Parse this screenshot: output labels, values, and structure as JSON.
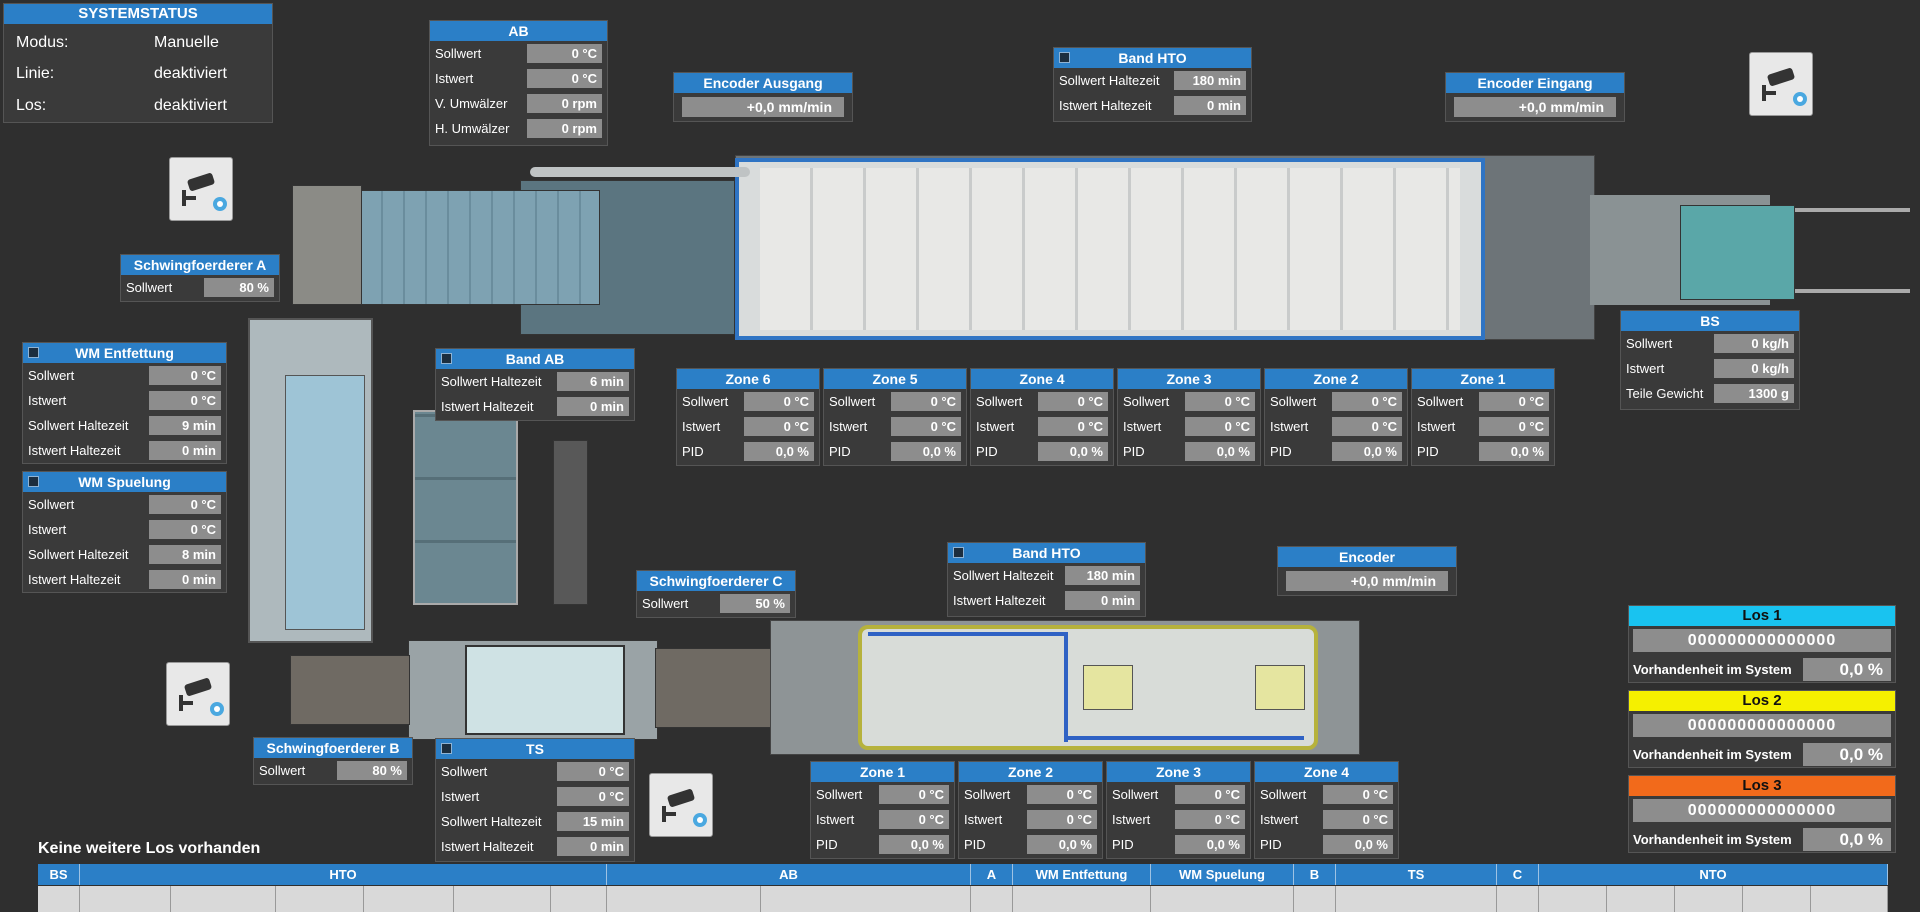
{
  "system_status": {
    "title": "SYSTEMSTATUS",
    "rows": [
      {
        "label": "Modus:",
        "value": "Manuelle"
      },
      {
        "label": "Linie:",
        "value": "deaktiviert"
      },
      {
        "label": "Los:",
        "value": "deaktiviert"
      }
    ]
  },
  "ab": {
    "title": "AB",
    "rows": [
      {
        "label": "Sollwert",
        "value": "0 °C"
      },
      {
        "label": "Istwert",
        "value": "0 °C"
      },
      {
        "label": "V. Umwälzer",
        "value": "0 rpm"
      },
      {
        "label": "H. Umwälzer",
        "value": "0 rpm"
      }
    ]
  },
  "encoder_ausgang": {
    "title": "Encoder Ausgang",
    "value": "+0,0 mm/min"
  },
  "band_hto_top": {
    "title": "Band HTO",
    "rows": [
      {
        "label": "Sollwert Haltezeit",
        "value": "180 min"
      },
      {
        "label": "Istwert Haltezeit",
        "value": "0 min"
      }
    ]
  },
  "encoder_eingang": {
    "title": "Encoder Eingang",
    "value": "+0,0 mm/min"
  },
  "schwingfoerderer_a": {
    "title": "Schwingfoerderer A",
    "rows": [
      {
        "label": "Sollwert",
        "value": "80 %"
      }
    ]
  },
  "wm_entfettung": {
    "title": "WM Entfettung",
    "rows": [
      {
        "label": "Sollwert",
        "value": "0 °C"
      },
      {
        "label": "Istwert",
        "value": "0 °C"
      },
      {
        "label": "Sollwert Haltezeit",
        "value": "9 min"
      },
      {
        "label": "Istwert Haltezeit",
        "value": "0 min"
      }
    ]
  },
  "wm_spuelung": {
    "title": "WM Spuelung",
    "rows": [
      {
        "label": "Sollwert",
        "value": "0 °C"
      },
      {
        "label": "Istwert",
        "value": "0 °C"
      },
      {
        "label": "Sollwert Haltezeit",
        "value": "8 min"
      },
      {
        "label": "Istwert Haltezeit",
        "value": "0 min"
      }
    ]
  },
  "band_ab": {
    "title": "Band AB",
    "rows": [
      {
        "label": "Sollwert Haltezeit",
        "value": "6 min"
      },
      {
        "label": "Istwert Haltezeit",
        "value": "0 min"
      }
    ]
  },
  "bs": {
    "title": "BS",
    "rows": [
      {
        "label": "Sollwert",
        "value": "0 kg/h"
      },
      {
        "label": "Istwert",
        "value": "0 kg/h"
      },
      {
        "label": "Teile Gewicht",
        "value": "1300 g"
      }
    ]
  },
  "top_zones": [
    {
      "title": "Zone 6",
      "rows": [
        {
          "label": "Sollwert",
          "value": "0 °C"
        },
        {
          "label": "Istwert",
          "value": "0 °C"
        },
        {
          "label": "PID",
          "value": "0,0 %"
        }
      ]
    },
    {
      "title": "Zone 5",
      "rows": [
        {
          "label": "Sollwert",
          "value": "0 °C"
        },
        {
          "label": "Istwert",
          "value": "0 °C"
        },
        {
          "label": "PID",
          "value": "0,0 %"
        }
      ]
    },
    {
      "title": "Zone 4",
      "rows": [
        {
          "label": "Sollwert",
          "value": "0 °C"
        },
        {
          "label": "Istwert",
          "value": "0 °C"
        },
        {
          "label": "PID",
          "value": "0,0 %"
        }
      ]
    },
    {
      "title": "Zone 3",
      "rows": [
        {
          "label": "Sollwert",
          "value": "0 °C"
        },
        {
          "label": "Istwert",
          "value": "0 °C"
        },
        {
          "label": "PID",
          "value": "0,0 %"
        }
      ]
    },
    {
      "title": "Zone 2",
      "rows": [
        {
          "label": "Sollwert",
          "value": "0 °C"
        },
        {
          "label": "Istwert",
          "value": "0 °C"
        },
        {
          "label": "PID",
          "value": "0,0 %"
        }
      ]
    },
    {
      "title": "Zone 1",
      "rows": [
        {
          "label": "Sollwert",
          "value": "0 °C"
        },
        {
          "label": "Istwert",
          "value": "0 °C"
        },
        {
          "label": "PID",
          "value": "0,0 %"
        }
      ]
    }
  ],
  "band_hto_bottom": {
    "title": "Band HTO",
    "rows": [
      {
        "label": "Sollwert Haltezeit",
        "value": "180 min"
      },
      {
        "label": "Istwert Haltezeit",
        "value": "0 min"
      }
    ]
  },
  "encoder_bottom": {
    "title": "Encoder",
    "value": "+0,0 mm/min"
  },
  "schwingfoerderer_c": {
    "title": "Schwingfoerderer C",
    "rows": [
      {
        "label": "Sollwert",
        "value": "50 %"
      }
    ]
  },
  "schwingfoerderer_b": {
    "title": "Schwingfoerderer B",
    "rows": [
      {
        "label": "Sollwert",
        "value": "80 %"
      }
    ]
  },
  "ts": {
    "title": "TS",
    "rows": [
      {
        "label": "Sollwert",
        "value": "0 °C"
      },
      {
        "label": "Istwert",
        "value": "0 °C"
      },
      {
        "label": "Sollwert Haltezeit",
        "value": "15 min"
      },
      {
        "label": "Istwert Haltezeit",
        "value": "0 min"
      }
    ]
  },
  "bottom_zones": [
    {
      "title": "Zone 1",
      "rows": [
        {
          "label": "Sollwert",
          "value": "0 °C"
        },
        {
          "label": "Istwert",
          "value": "0 °C"
        },
        {
          "label": "PID",
          "value": "0,0 %"
        }
      ]
    },
    {
      "title": "Zone 2",
      "rows": [
        {
          "label": "Sollwert",
          "value": "0 °C"
        },
        {
          "label": "Istwert",
          "value": "0 °C"
        },
        {
          "label": "PID",
          "value": "0,0 %"
        }
      ]
    },
    {
      "title": "Zone 3",
      "rows": [
        {
          "label": "Sollwert",
          "value": "0 °C"
        },
        {
          "label": "Istwert",
          "value": "0 °C"
        },
        {
          "label": "PID",
          "value": "0,0 %"
        }
      ]
    },
    {
      "title": "Zone 4",
      "rows": [
        {
          "label": "Sollwert",
          "value": "0 °C"
        },
        {
          "label": "Istwert",
          "value": "0 °C"
        },
        {
          "label": "PID",
          "value": "0,0 %"
        }
      ]
    }
  ],
  "los": [
    {
      "title": "Los 1",
      "code": "000000000000000",
      "label": "Vorhandenheit im System",
      "value": "0,0 %",
      "color": "#19c3f0"
    },
    {
      "title": "Los 2",
      "code": "000000000000000",
      "label": "Vorhandenheit im System",
      "value": "0,0 %",
      "color": "#f5f000"
    },
    {
      "title": "Los 3",
      "code": "000000000000000",
      "label": "Vorhandenheit im System",
      "value": "0,0 %",
      "color": "#f26a1b"
    }
  ],
  "no_more_los": "Keine weitere Los vorhanden",
  "table_headers": [
    "BS",
    "HTO",
    "AB",
    "A",
    "WM Entfettung",
    "WM Spuelung",
    "B",
    "TS",
    "C",
    "NTO"
  ],
  "colors": {
    "header_blue": "#2b7fc7",
    "background": "#2f2f2f",
    "value_gray": "#8d8d8d"
  },
  "icons": {
    "camera": "security-camera-icon"
  }
}
